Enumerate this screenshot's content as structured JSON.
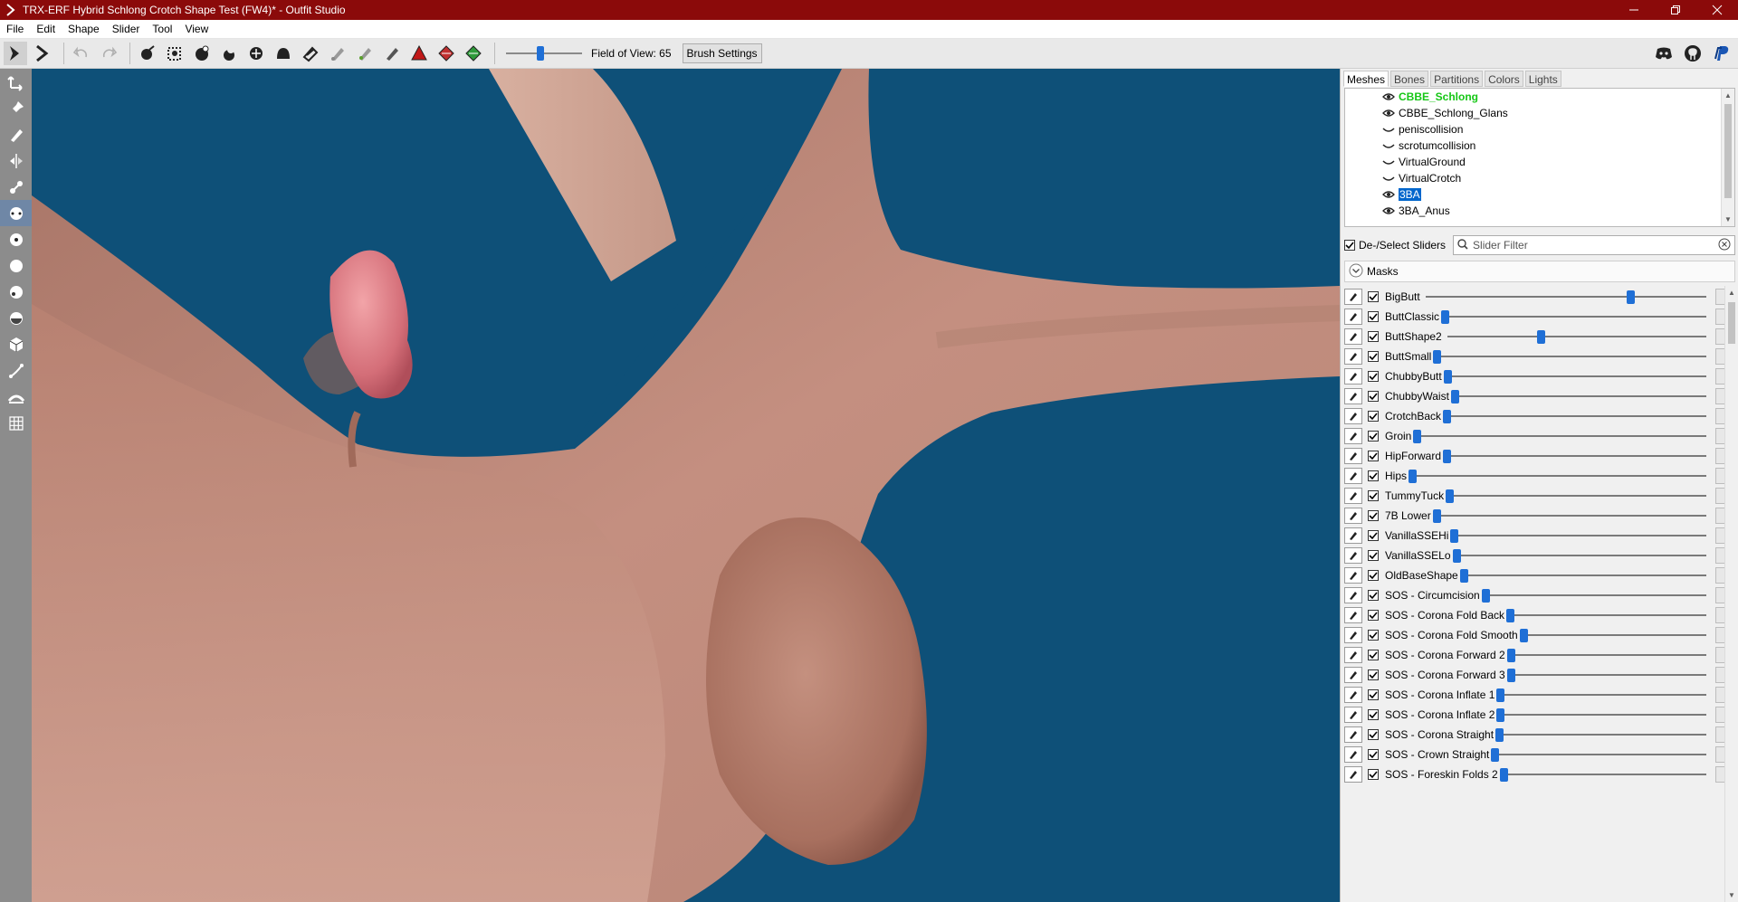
{
  "window": {
    "title": "TRX-ERF Hybrid Schlong Crotch Shape Test (FW4)* - Outfit Studio",
    "controls": [
      "minimize-icon",
      "restore-icon",
      "close-icon"
    ],
    "titlebar_color": "#8b0a0a"
  },
  "menu": [
    "File",
    "Edit",
    "Shape",
    "Slider",
    "Tool",
    "View"
  ],
  "toolbar": {
    "field_of_view_label": "Field of View: 65",
    "field_of_view_value": 65,
    "brush_settings_label": "Brush Settings",
    "right_icons": [
      "discord-icon",
      "github-icon",
      "paypal-icon"
    ]
  },
  "viewport": {
    "background_color": "#0e5078"
  },
  "panel": {
    "tabs": [
      "Meshes",
      "Bones",
      "Partitions",
      "Colors",
      "Lights"
    ],
    "active_tab": "Meshes",
    "meshes": [
      {
        "name": "CBBE_Schlong",
        "icon": "eye-icon",
        "state": "active"
      },
      {
        "name": "CBBE_Schlong_Glans",
        "icon": "eye-icon",
        "state": ""
      },
      {
        "name": "peniscollision",
        "icon": "closed-eye-icon",
        "state": ""
      },
      {
        "name": "scrotumcollision",
        "icon": "closed-eye-icon",
        "state": ""
      },
      {
        "name": "VirtualGround",
        "icon": "closed-eye-icon",
        "state": ""
      },
      {
        "name": "VirtualCrotch",
        "icon": "closed-eye-icon",
        "state": ""
      },
      {
        "name": "3BA",
        "icon": "eye-icon",
        "state": "selected"
      },
      {
        "name": "3BA_Anus",
        "icon": "eye-icon",
        "state": ""
      }
    ],
    "deselect_label": "De-/Select Sliders",
    "filter_placeholder": "Slider Filter",
    "masks_label": "Masks",
    "accent_color": "#1f6fd6"
  },
  "sliders": [
    {
      "name": "BigButt",
      "value": 0.73
    },
    {
      "name": "ButtClassic",
      "value": 0.0
    },
    {
      "name": "ButtShape2",
      "value": 0.36
    },
    {
      "name": "ButtSmall",
      "value": 0.0
    },
    {
      "name": "ChubbyButt",
      "value": 0.0
    },
    {
      "name": "ChubbyWaist",
      "value": 0.0
    },
    {
      "name": "CrotchBack",
      "value": 0.0
    },
    {
      "name": "Groin",
      "value": 0.0
    },
    {
      "name": "HipForward",
      "value": 0.0
    },
    {
      "name": "Hips",
      "value": 0.0
    },
    {
      "name": "TummyTuck",
      "value": 0.0
    },
    {
      "name": "7B Lower",
      "value": 0.0
    },
    {
      "name": "VanillaSSEHi",
      "value": 0.0
    },
    {
      "name": "VanillaSSELo",
      "value": 0.0
    },
    {
      "name": "OldBaseShape",
      "value": 0.0
    },
    {
      "name": "SOS - Circumcision",
      "value": 0.0
    },
    {
      "name": "SOS - Corona Fold Back",
      "value": 0.0
    },
    {
      "name": "SOS - Corona Fold Smooth",
      "value": 0.0
    },
    {
      "name": "SOS - Corona Forward 2",
      "value": 0.0
    },
    {
      "name": "SOS - Corona Forward 3",
      "value": 0.0
    },
    {
      "name": "SOS - Corona Inflate 1",
      "value": 0.0
    },
    {
      "name": "SOS - Corona Inflate 2",
      "value": 0.0
    },
    {
      "name": "SOS - Corona Straight",
      "value": 0.0
    },
    {
      "name": "SOS - Crown Straight",
      "value": 0.0
    },
    {
      "name": "SOS - Foreskin Folds 2",
      "value": 0.0
    }
  ]
}
